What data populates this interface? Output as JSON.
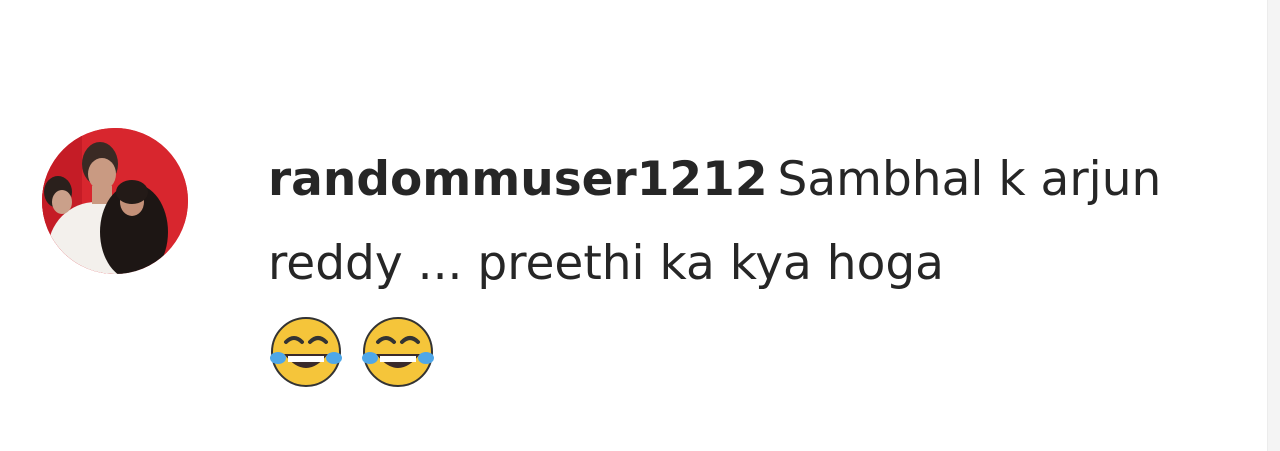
{
  "comment": {
    "username": "randommuser1212",
    "text": "Sambhal k arjun reddy ... preethi ka kya hoga",
    "emojis": [
      "face-with-tears-of-joy",
      "face-with-tears-of-joy"
    ],
    "avatar_bg": "#d8262e"
  },
  "colors": {
    "text": "#262626",
    "meta": "#8e8e8e",
    "background": "#ffffff"
  }
}
